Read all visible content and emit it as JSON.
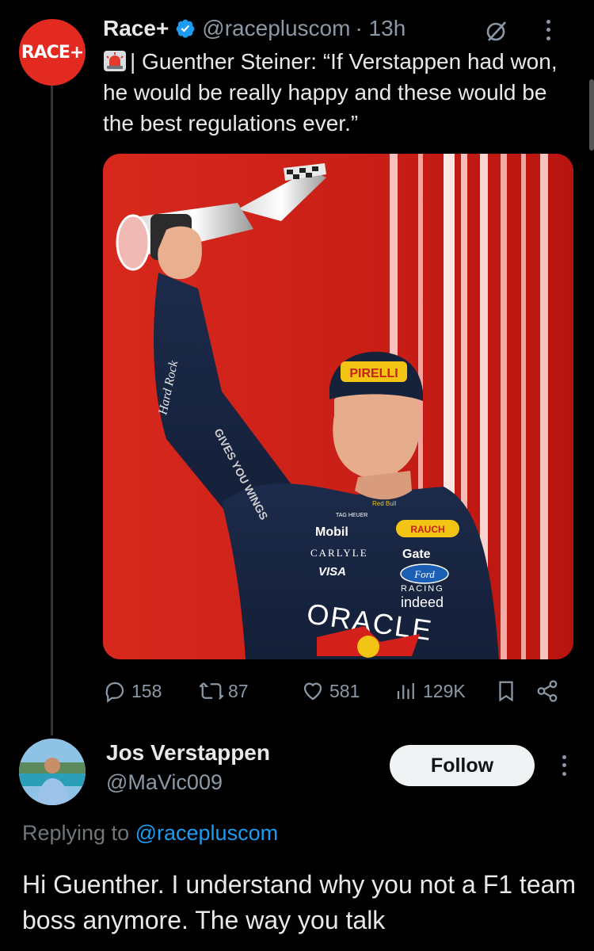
{
  "tweet": {
    "author_name": "Race+",
    "author_handle": "@racepluscom",
    "time": "· 13h",
    "avatar_text": "RACE+",
    "text": "| Guenther Steiner: “If Verstappen had won, he would be really happy and these would be the best regulations ever.”",
    "media_text": {
      "sponsor_oracle": "ORACLE",
      "sponsor_visa": "VISA",
      "sponsor_gate": "Gate",
      "sponsor_ford": "Ford",
      "sponsor_indeed": "indeed",
      "sponsor_rauch": "RAUCH",
      "sponsor_mobil": "Mobil",
      "sponsor_carlyle": "CARLYLE",
      "sponsor_racing": "RACING",
      "sponsor_hardrock": "Hard Rock",
      "sponsor_pirelli": "PIRELLI",
      "sponsor_redbull": "Red Bull",
      "sponsor_wings": "GIVES YOU WINGS",
      "sponsor_tag": "TAG HEUER"
    },
    "stats": {
      "replies": "158",
      "reposts": "87",
      "likes": "581",
      "views": "129K"
    }
  },
  "reply": {
    "author_name": "Jos Verstappen",
    "author_handle": "@MaVic009",
    "follow_label": "Follow",
    "replying_prefix": "Replying to",
    "replying_handle": "@racepluscom",
    "text": "Hi Guenther.  I understand why you not a F1 team boss anymore. The way you talk"
  },
  "colors": {
    "background": "#000000",
    "text_primary": "#e7e9ea",
    "text_secondary": "#8b98a5",
    "link": "#1d9bf0",
    "verified": "#1d9bf0",
    "race_brand": "#e32a20"
  },
  "icons": [
    "verified-badge-icon",
    "grok-icon",
    "more-icon",
    "siren-emoji-icon",
    "reply-icon",
    "repost-icon",
    "like-icon",
    "views-icon",
    "bookmark-icon",
    "share-icon"
  ]
}
